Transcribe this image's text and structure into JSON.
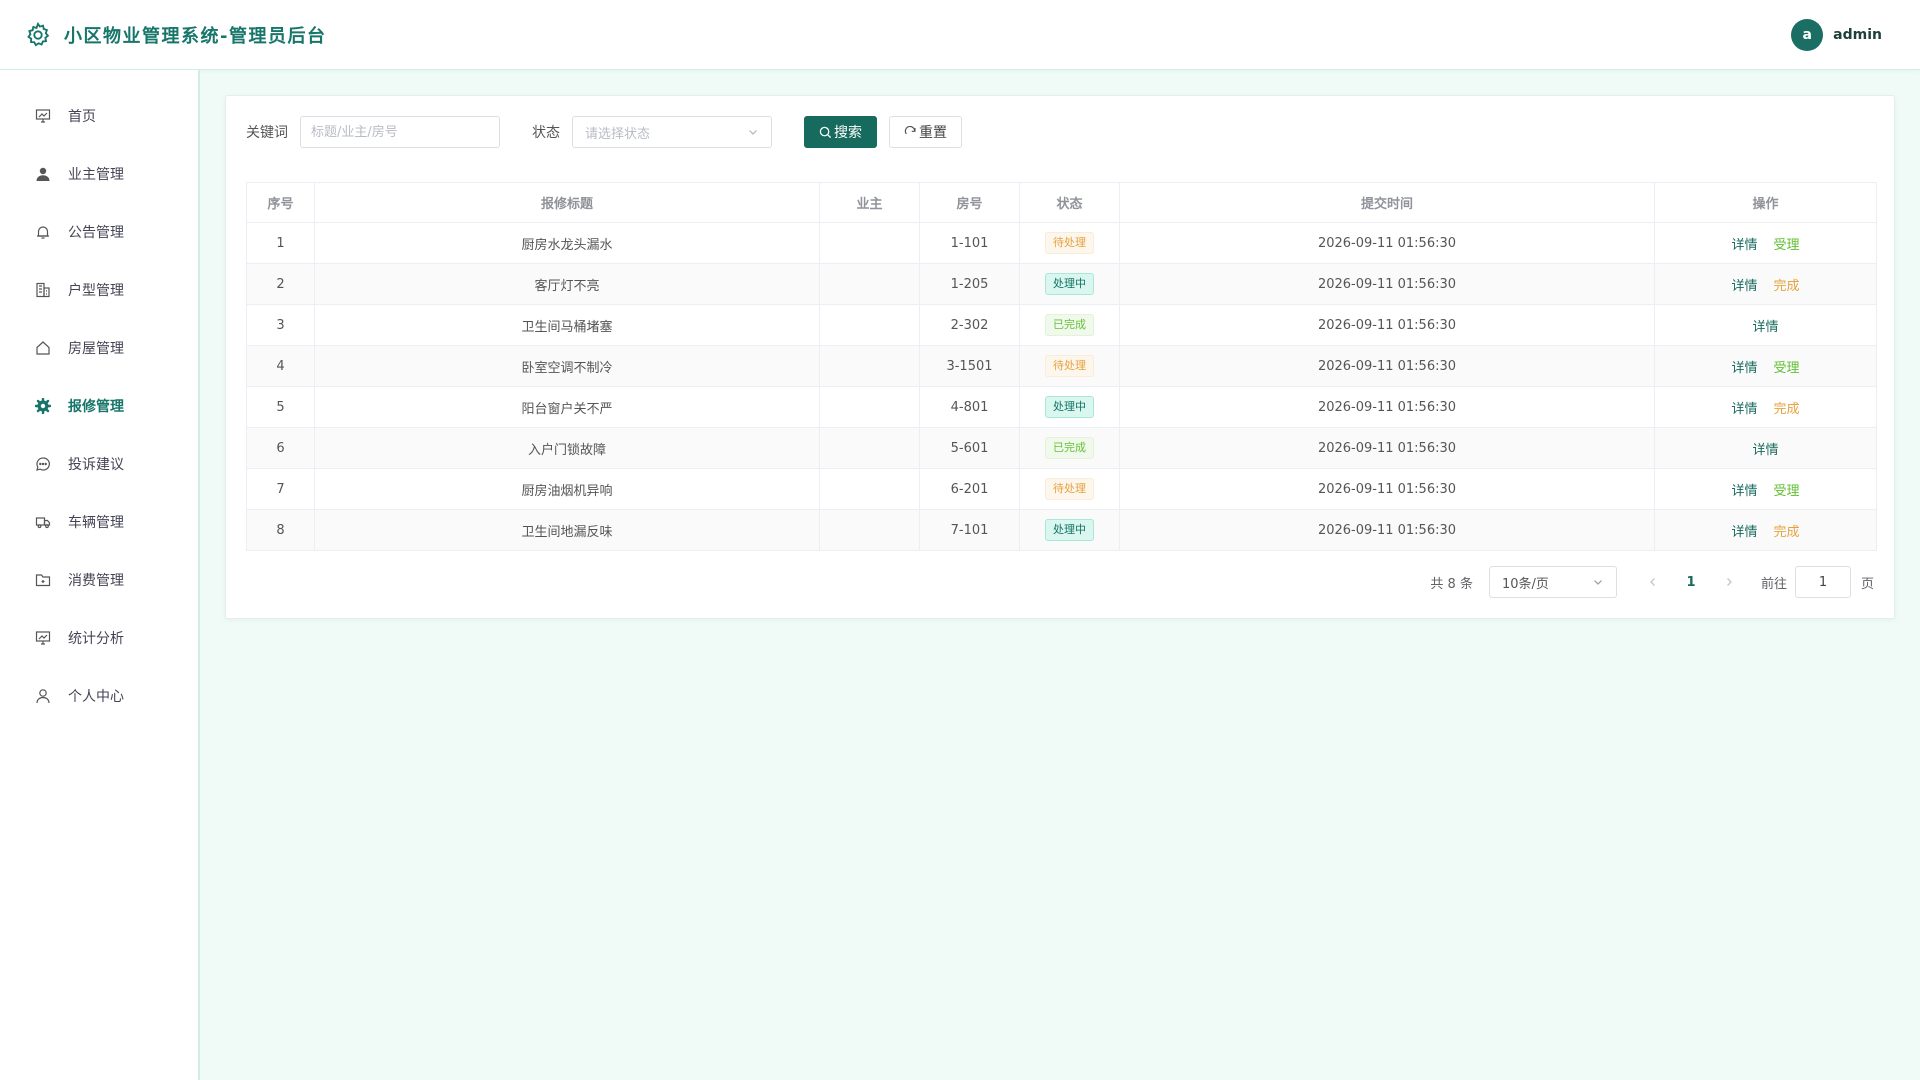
{
  "header": {
    "title": "小区物业管理系统-管理员后台",
    "user": {
      "avatar_letter": "a",
      "name": "admin"
    }
  },
  "sidebar": {
    "items": [
      {
        "label": "首页",
        "icon": "dashboard-icon"
      },
      {
        "label": "业主管理",
        "icon": "user-icon"
      },
      {
        "label": "公告管理",
        "icon": "bell-icon"
      },
      {
        "label": "户型管理",
        "icon": "building-icon"
      },
      {
        "label": "房屋管理",
        "icon": "house-icon"
      },
      {
        "label": "报修管理",
        "icon": "gear-icon",
        "active": true
      },
      {
        "label": "投诉建议",
        "icon": "chat-icon"
      },
      {
        "label": "车辆管理",
        "icon": "truck-icon"
      },
      {
        "label": "消费管理",
        "icon": "folder-icon"
      },
      {
        "label": "统计分析",
        "icon": "chart-icon"
      },
      {
        "label": "个人中心",
        "icon": "person-icon"
      }
    ]
  },
  "filter": {
    "keyword_label": "关键词",
    "keyword_placeholder": "标题/业主/房号",
    "keyword_value": "",
    "status_label": "状态",
    "status_placeholder": "请选择状态",
    "search_label": "搜索",
    "reset_label": "重置"
  },
  "table": {
    "columns": [
      "序号",
      "报修标题",
      "业主",
      "房号",
      "状态",
      "提交时间",
      "操作"
    ],
    "rows": [
      {
        "idx": "1",
        "title": "厨房水龙头漏水",
        "owner": "",
        "room": "1-101",
        "status": "待处理",
        "time": "2026-09-11 01:56:30",
        "ops": [
          "详情",
          "受理"
        ]
      },
      {
        "idx": "2",
        "title": "客厅灯不亮",
        "owner": "",
        "room": "1-205",
        "status": "处理中",
        "time": "2026-09-11 01:56:30",
        "ops": [
          "详情",
          "完成"
        ]
      },
      {
        "idx": "3",
        "title": "卫生间马桶堵塞",
        "owner": "",
        "room": "2-302",
        "status": "已完成",
        "time": "2026-09-11 01:56:30",
        "ops": [
          "详情"
        ]
      },
      {
        "idx": "4",
        "title": "卧室空调不制冷",
        "owner": "",
        "room": "3-1501",
        "status": "待处理",
        "time": "2026-09-11 01:56:30",
        "ops": [
          "详情",
          "受理"
        ]
      },
      {
        "idx": "5",
        "title": "阳台窗户关不严",
        "owner": "",
        "room": "4-801",
        "status": "处理中",
        "time": "2026-09-11 01:56:30",
        "ops": [
          "详情",
          "完成"
        ]
      },
      {
        "idx": "6",
        "title": "入户门锁故障",
        "owner": "",
        "room": "5-601",
        "status": "已完成",
        "time": "2026-09-11 01:56:30",
        "ops": [
          "详情"
        ]
      },
      {
        "idx": "7",
        "title": "厨房油烟机异响",
        "owner": "",
        "room": "6-201",
        "status": "待处理",
        "time": "2026-09-11 01:56:30",
        "ops": [
          "详情",
          "受理"
        ]
      },
      {
        "idx": "8",
        "title": "卫生间地漏反味",
        "owner": "",
        "room": "7-101",
        "status": "处理中",
        "time": "2026-09-11 01:56:30",
        "ops": [
          "详情",
          "完成"
        ]
      }
    ]
  },
  "pagination": {
    "total_text": "共 8 条",
    "page_size": "10条/页",
    "current_page": "1",
    "goto_label": "前往",
    "goto_value": "1",
    "page_suffix": "页"
  },
  "colors": {
    "primary": "#176a5e",
    "background": "#f0fbf8",
    "pending": "#e6a23c",
    "processing": "#137266",
    "done": "#67c23a"
  }
}
